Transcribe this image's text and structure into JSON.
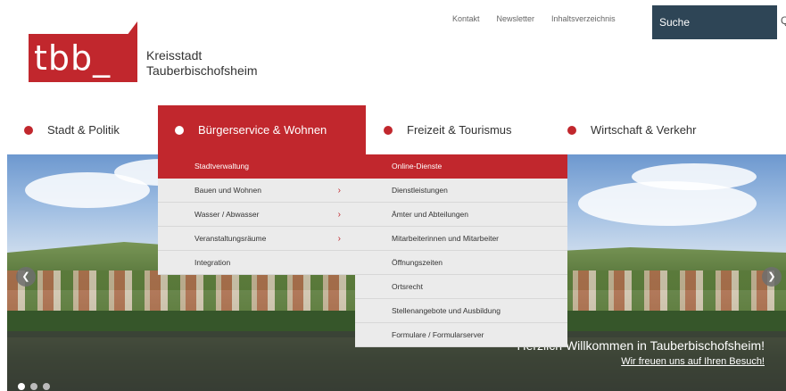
{
  "header": {
    "logo_text": "tbb_",
    "city_line1": "Kreisstadt",
    "city_line2": "Tauberbischofsheim",
    "brand_color": "#c1272d"
  },
  "toplinks": [
    "Kontakt",
    "Newsletter",
    "Inhaltsverzeichnis"
  ],
  "search": {
    "placeholder": "Suche",
    "bg_color": "#2e4556"
  },
  "nav": [
    {
      "label": "Stadt & Politik",
      "active": false
    },
    {
      "label": "Bürgerservice & Wohnen",
      "active": true
    },
    {
      "label": "Freizeit & Tourismus",
      "active": false
    },
    {
      "label": "Wirtschaft & Verkehr",
      "active": false
    }
  ],
  "dropdown": {
    "left_header": "Stadtverwaltung",
    "left_items": [
      {
        "label": "Bauen und Wohnen",
        "has_sub": true
      },
      {
        "label": "Wasser / Abwasser",
        "has_sub": true
      },
      {
        "label": "Veranstaltungsräume",
        "has_sub": true
      },
      {
        "label": "Integration",
        "has_sub": false
      }
    ],
    "right_header": "Online-Dienste",
    "right_items": [
      "Dienstleistungen",
      "Ämter und Abteilungen",
      "Mitarbeiterinnen und Mitarbeiter",
      "Öffnungszeiten",
      "Ortsrecht",
      "Stellenangebote und Ausbildung",
      "Formulare / Formularserver"
    ]
  },
  "hero": {
    "caption_title": "Herzlich Willkommen in Tauberbischofsheim!",
    "caption_link": "Wir freuen uns auf Ihren Besuch!",
    "prev_icon": "chevron-left-icon",
    "next_icon": "chevron-right-icon"
  }
}
